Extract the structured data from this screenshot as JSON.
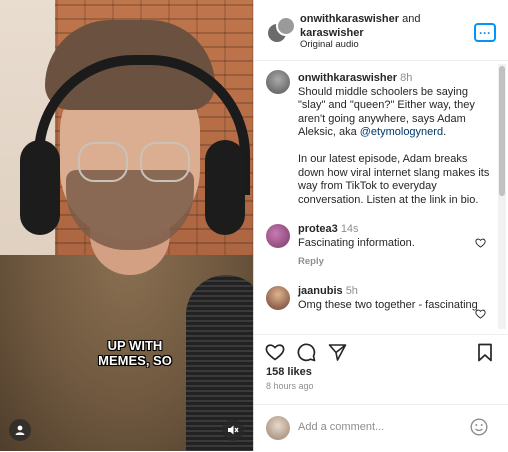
{
  "video": {
    "caption_text": "UP WITH MEMES, SO"
  },
  "header": {
    "user1": "onwithkaraswisher",
    "joiner": " and ",
    "user2": "karaswisher",
    "audio": "Original audio"
  },
  "post": {
    "username": "onwithkaraswisher",
    "time": "8h",
    "text_1": "Should middle schoolers be saying \"slay\" and \"queen?\" Either way, they aren't going anywhere, says Adam Aleksic, aka ",
    "mention": "@etymologynerd",
    "text_1_end": ".",
    "text_2": "In our latest episode, Adam breaks down how viral internet slang makes its way from TikTok to everyday conversation. Listen at the link in bio."
  },
  "comments": [
    {
      "username": "protea3",
      "time": "14s",
      "text": "Fascinating information.",
      "reply_label": "Reply"
    },
    {
      "username": "jaanubis",
      "time": "5h",
      "text": "Omg these two together - fascinating"
    }
  ],
  "stats": {
    "likes": "158 likes",
    "ago": "8 hours ago"
  },
  "composer": {
    "placeholder": "Add a comment..."
  },
  "colors": {
    "accent": "#0095f6",
    "link": "#00376b",
    "muted": "#8e8e8e"
  }
}
